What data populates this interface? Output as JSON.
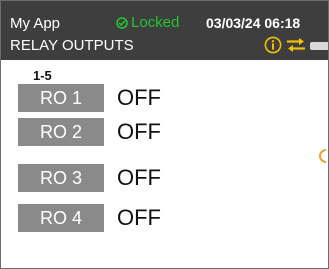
{
  "header": {
    "app_name": "My App",
    "lock_status": "Locked",
    "datetime": "03/03/24 06:18",
    "page_title": "RELAY OUTPUTS",
    "icons": [
      "lock-icon",
      "info-icon",
      "transfer-icon",
      "battery-icon"
    ]
  },
  "relays": {
    "range_label": "1-5",
    "items": [
      {
        "name": "RO 1",
        "state": "OFF"
      },
      {
        "name": "RO 2",
        "state": "OFF"
      },
      {
        "name": "RO 3",
        "state": "OFF"
      },
      {
        "name": "RO 4",
        "state": "OFF"
      }
    ]
  },
  "colors": {
    "header_bg": "#3e3e3e",
    "locked_green": "#22c52c",
    "icon_yellow": "#f2c200",
    "relay_tag_bg": "#8a8a8a",
    "accent_orange": "#f0a030"
  }
}
